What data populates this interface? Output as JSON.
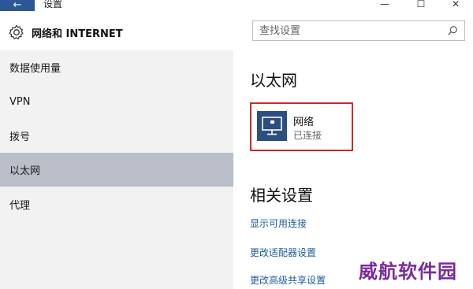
{
  "window": {
    "title": "设置",
    "back_glyph": "←",
    "minimize_glyph": "—",
    "maximize_glyph": "☐",
    "close_glyph": "✕"
  },
  "header": {
    "title": "网络和 INTERNET",
    "icon": "gear-icon"
  },
  "search": {
    "placeholder": "查找设置",
    "icon": "search-icon"
  },
  "sidebar": {
    "items": [
      {
        "label": "数据使用量"
      },
      {
        "label": "VPN"
      },
      {
        "label": "拨号"
      },
      {
        "label": "以太网",
        "selected": true
      },
      {
        "label": "代理"
      }
    ]
  },
  "main": {
    "heading": "以太网",
    "network": {
      "name": "网络",
      "status": "已连接",
      "icon": "ethernet-icon"
    },
    "related": {
      "heading": "相关设置",
      "links": [
        "显示可用连接",
        "更改适配器设置",
        "更改高级共享设置"
      ]
    }
  },
  "watermark": "威航软件园",
  "colors": {
    "accent": "#2b5797",
    "selected_bg": "#b9bec9",
    "highlight_border": "#cc2a2a",
    "link": "#1d5c9e"
  }
}
